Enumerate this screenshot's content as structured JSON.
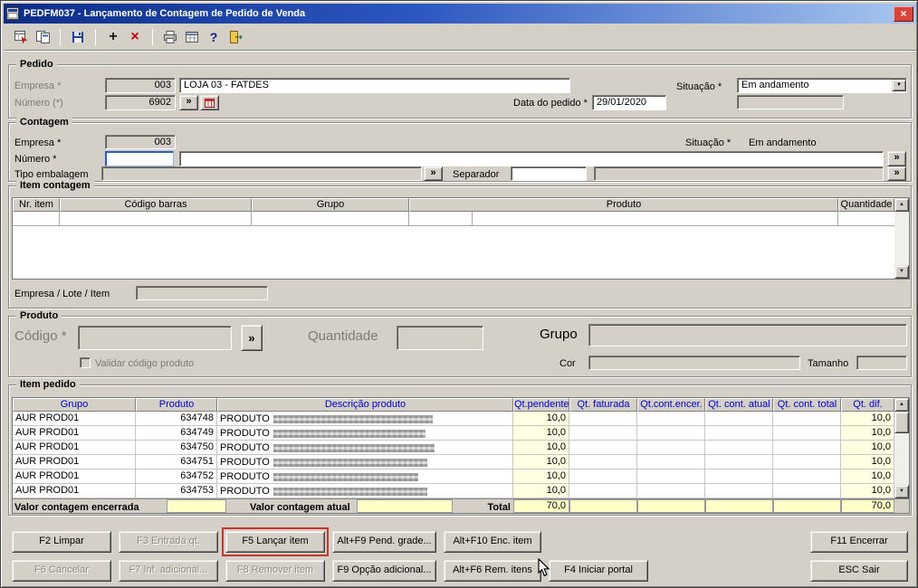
{
  "glyphs": {
    "lookup": "»",
    "dropdown": "▼",
    "up": "▲",
    "down": "▼",
    "plus": "+",
    "delete": "×",
    "help": "?",
    "close": "×"
  },
  "titlebar": {
    "title": "PEDFM037 - Lançamento de Contagem de Pedido de Venda"
  },
  "pedido": {
    "group_label": "Pedido",
    "empresa_label": "Empresa *",
    "empresa_code": "003",
    "empresa_name": "LOJA 03 - FATDES",
    "numero_label": "Número (*)",
    "numero_value": "6902",
    "data_pedido_label": "Data do pedido *",
    "data_pedido_value": "29/01/2020",
    "situacao_label": "Situação *",
    "situacao_value": "Em andamento"
  },
  "contagem": {
    "group_label": "Contagem",
    "empresa_label": "Empresa *",
    "empresa_code": "003",
    "numero_label": "Número *",
    "tipo_embalagem_label": "Tipo embalagem",
    "separador_label": "Separador",
    "situacao_label": "Situação *",
    "situacao_value": "Em andamento"
  },
  "item_contagem": {
    "group_label": "Item contagem",
    "columns": [
      "Nr. item",
      "Código barras",
      "Grupo",
      "Produto",
      "Quantidade"
    ],
    "empresa_lote_item_label": "Empresa / Lote / Item"
  },
  "produto": {
    "group_label": "Produto",
    "codigo_label": "Código *",
    "quantidade_label": "Quantidade",
    "grupo_label": "Grupo",
    "validar_label": "Validar código produto",
    "cor_label": "Cor",
    "tamanho_label": "Tamanho"
  },
  "item_pedido": {
    "group_label": "Item pedido",
    "columns": [
      "Grupo",
      "Produto",
      "Descrição produto",
      "Qt.pendente",
      "Qt. faturada",
      "Qt.cont.encer.",
      "Qt. cont. atual",
      "Qt. cont. total",
      "Qt. dif."
    ],
    "rows": [
      {
        "grupo": "AUR PROD01",
        "produto": "634748",
        "descricao": "PRODUTO",
        "qt_pendente": "10,0",
        "qt_dif": "10,0"
      },
      {
        "grupo": "AUR PROD01",
        "produto": "634749",
        "descricao": "PRODUTO",
        "qt_pendente": "10,0",
        "qt_dif": "10,0"
      },
      {
        "grupo": "AUR PROD01",
        "produto": "634750",
        "descricao": "PRODUTO",
        "qt_pendente": "10,0",
        "qt_dif": "10,0"
      },
      {
        "grupo": "AUR PROD01",
        "produto": "634751",
        "descricao": "PRODUTO",
        "qt_pendente": "10,0",
        "qt_dif": "10,0"
      },
      {
        "grupo": "AUR PROD01",
        "produto": "634752",
        "descricao": "PRODUTO",
        "qt_pendente": "10,0",
        "qt_dif": "10,0"
      },
      {
        "grupo": "AUR PROD01",
        "produto": "634753",
        "descricao": "PRODUTO",
        "qt_pendente": "10,0",
        "qt_dif": "10,0"
      }
    ],
    "footer": {
      "valor_encerrada_label": "Valor contagem encerrada",
      "valor_atual_label": "Valor contagem atual",
      "total_label": "Total",
      "total_pendente": "70,0",
      "total_dif": "70,0"
    }
  },
  "buttons": {
    "f2": "F2 Limpar",
    "f3": "F3 Entrada qt.",
    "f5": "F5 Lançar item",
    "altf9": "Alt+F9 Pend. grade...",
    "altf10": "Alt+F10 Enc. item",
    "f11": "F11 Encerrar",
    "f6": "F6 Cancelar",
    "f7": "F7 Inf. adicional...",
    "f8": "F8 Remover item",
    "f9": "F9 Opção adicional...",
    "altf6": "Alt+F6 Rem. itens",
    "f4": "F4 Iniciar portal",
    "esc": "ESC Sair"
  }
}
